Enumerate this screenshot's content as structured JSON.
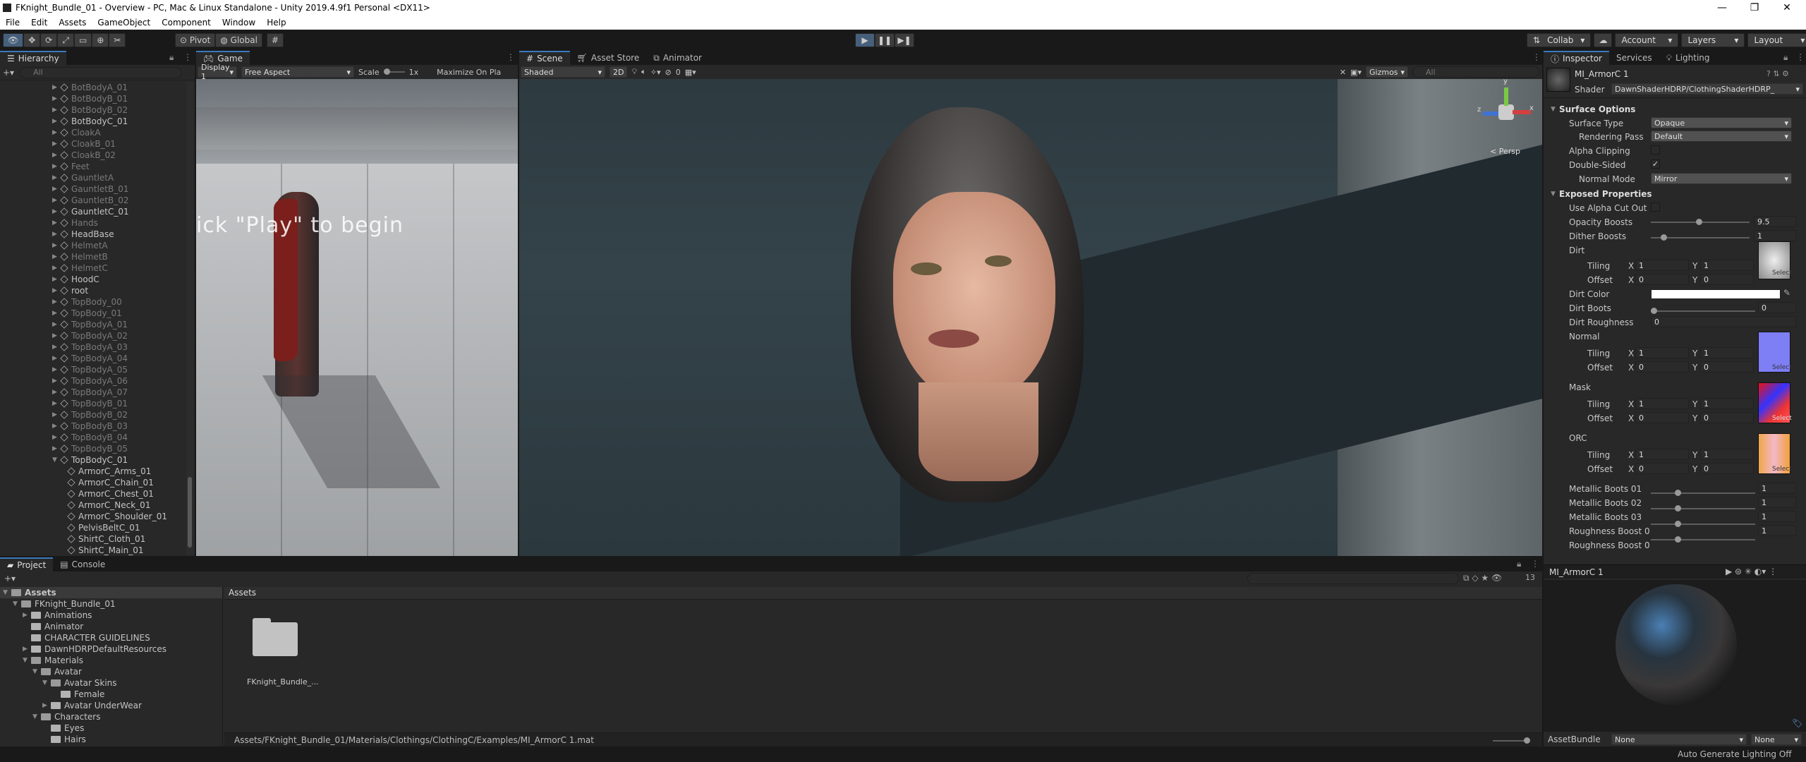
{
  "window": {
    "title": "FKnight_Bundle_01 - Overview - PC, Mac & Linux Standalone - Unity 2019.4.9f1 Personal <DX11>"
  },
  "menu": [
    "File",
    "Edit",
    "Assets",
    "GameObject",
    "Component",
    "Window",
    "Help"
  ],
  "toolbar": {
    "pivot": "Pivot",
    "global": "Global",
    "collab": "Collab",
    "account": "Account",
    "layers": "Layers",
    "layout": "Layout"
  },
  "hierarchy": {
    "tab": "Hierarchy",
    "search_placeholder": "All",
    "items": [
      {
        "label": "BotBodyA_01",
        "dim": true,
        "depth": 1
      },
      {
        "label": "BotBodyB_01",
        "dim": true,
        "depth": 1
      },
      {
        "label": "BotBodyB_02",
        "dim": true,
        "depth": 1
      },
      {
        "label": "BotBodyC_01",
        "dim": false,
        "depth": 1
      },
      {
        "label": "CloakA",
        "dim": true,
        "depth": 1
      },
      {
        "label": "CloakB_01",
        "dim": true,
        "depth": 1
      },
      {
        "label": "CloakB_02",
        "dim": true,
        "depth": 1
      },
      {
        "label": "Feet",
        "dim": true,
        "depth": 1
      },
      {
        "label": "GauntletA",
        "dim": true,
        "depth": 1
      },
      {
        "label": "GauntletB_01",
        "dim": true,
        "depth": 1
      },
      {
        "label": "GauntletB_02",
        "dim": true,
        "depth": 1
      },
      {
        "label": "GauntletC_01",
        "dim": false,
        "depth": 1
      },
      {
        "label": "Hands",
        "dim": true,
        "depth": 1
      },
      {
        "label": "HeadBase",
        "dim": false,
        "depth": 1
      },
      {
        "label": "HelmetA",
        "dim": true,
        "depth": 1
      },
      {
        "label": "HelmetB",
        "dim": true,
        "depth": 1
      },
      {
        "label": "HelmetC",
        "dim": true,
        "depth": 1
      },
      {
        "label": "HoodC",
        "dim": false,
        "depth": 1
      },
      {
        "label": "root",
        "dim": false,
        "depth": 1
      },
      {
        "label": "TopBody_00",
        "dim": true,
        "depth": 1
      },
      {
        "label": "TopBody_01",
        "dim": true,
        "depth": 1
      },
      {
        "label": "TopBodyA_01",
        "dim": true,
        "depth": 1
      },
      {
        "label": "TopBodyA_02",
        "dim": true,
        "depth": 1
      },
      {
        "label": "TopBodyA_03",
        "dim": true,
        "depth": 1
      },
      {
        "label": "TopBodyA_04",
        "dim": true,
        "depth": 1
      },
      {
        "label": "TopBodyA_05",
        "dim": true,
        "depth": 1
      },
      {
        "label": "TopBodyA_06",
        "dim": true,
        "depth": 1
      },
      {
        "label": "TopBodyA_07",
        "dim": true,
        "depth": 1
      },
      {
        "label": "TopBodyB_01",
        "dim": true,
        "depth": 1
      },
      {
        "label": "TopBodyB_02",
        "dim": true,
        "depth": 1
      },
      {
        "label": "TopBodyB_03",
        "dim": true,
        "depth": 1
      },
      {
        "label": "TopBodyB_04",
        "dim": true,
        "depth": 1
      },
      {
        "label": "TopBodyB_05",
        "dim": true,
        "depth": 1
      },
      {
        "label": "TopBodyC_01",
        "dim": false,
        "depth": 1,
        "open": true
      },
      {
        "label": "ArmorC_Arms_01",
        "dim": false,
        "depth": 2
      },
      {
        "label": "ArmorC_Chain_01",
        "dim": false,
        "depth": 2
      },
      {
        "label": "ArmorC_Chest_01",
        "dim": false,
        "depth": 2
      },
      {
        "label": "ArmorC_Neck_01",
        "dim": false,
        "depth": 2
      },
      {
        "label": "ArmorC_Shoulder_01",
        "dim": false,
        "depth": 2
      },
      {
        "label": "PelvisBeltC_01",
        "dim": false,
        "depth": 2
      },
      {
        "label": "ShirtC_Cloth_01",
        "dim": false,
        "depth": 2
      },
      {
        "label": "ShirtC_Main_01",
        "dim": false,
        "depth": 2
      }
    ]
  },
  "game": {
    "tab": "Game",
    "display": "Display 1",
    "aspect": "Free Aspect",
    "scale_label": "Scale",
    "scale_value": "1x",
    "maximize": "Maximize On Pla",
    "overlay_text": "ick \"Play\" to begin"
  },
  "scene": {
    "tab": "Scene",
    "asset_store": "Asset Store",
    "animator": "Animator",
    "shading": "Shaded",
    "mode2d": "2D",
    "gizmos": "Gizmos",
    "search_placeholder": "All",
    "persp": "< Persp",
    "fx_count": "0",
    "axis_x": "x",
    "axis_y": "y",
    "axis_z": "z"
  },
  "inspector": {
    "tabs": [
      "Inspector",
      "Services",
      "Lighting"
    ],
    "material_name": "MI_ArmorC 1",
    "shader_label": "Shader",
    "shader_value": "DawnShaderHDRP/ClothingShaderHDRP_",
    "surface_options": "Surface Options",
    "surface_type_label": "Surface Type",
    "surface_type": "Opaque",
    "rendering_pass_label": "Rendering Pass",
    "rendering_pass": "Default",
    "alpha_clipping": "Alpha Clipping",
    "double_sided": "Double-Sided",
    "double_sided_check": "✓",
    "normal_mode_label": "Normal Mode",
    "normal_mode": "Mirror",
    "exposed": "Exposed Properties",
    "use_alpha_cut": "Use Alpha Cut Out",
    "opacity_label": "Opacity Boosts",
    "opacity_value": "9.5",
    "dither_label": "Dither Boosts",
    "dither_value": "1",
    "dirt": "Dirt",
    "tiling": "Tiling",
    "offset": "Offset",
    "x": "X",
    "y": "Y",
    "one": "1",
    "zero": "0",
    "dirt_color": "Dirt Color",
    "dirt_boots_label": "Dirt Boots",
    "dirt_boots_value": "0",
    "dirt_roughness_label": "Dirt Roughness",
    "dirt_roughness_value": "0",
    "normal": "Normal",
    "mask": "Mask",
    "orc": "ORC",
    "select": "Select",
    "metallic1": "Metallic Boots 01",
    "metallic2": "Metallic Boots 02",
    "metallic3": "Metallic Boots 03",
    "roughness0": "Roughness Boost 0",
    "roughness1": "Roughness Boost 0",
    "preview_name": "MI_ArmorC 1",
    "assetbundle_label": "AssetBundle",
    "assetbundle_value": "None",
    "assetbundle_variant": "None"
  },
  "project": {
    "tabs": [
      "Project",
      "Console"
    ],
    "badge": "13",
    "tree": [
      {
        "label": "Assets",
        "depth": 0,
        "open": true,
        "bold": true
      },
      {
        "label": "FKnight_Bundle_01",
        "depth": 1,
        "open": true
      },
      {
        "label": "Animations",
        "depth": 2,
        "open": false
      },
      {
        "label": "Animator",
        "depth": 2,
        "open": null
      },
      {
        "label": "CHARACTER GUIDELINES",
        "depth": 2,
        "open": null
      },
      {
        "label": "DawnHDRPDefaultResources",
        "depth": 2,
        "open": false
      },
      {
        "label": "Materials",
        "depth": 2,
        "open": true
      },
      {
        "label": "Avatar",
        "depth": 3,
        "open": true
      },
      {
        "label": "Avatar Skins",
        "depth": 4,
        "open": true
      },
      {
        "label": "Female",
        "depth": 5,
        "open": null
      },
      {
        "label": "Avatar UnderWear",
        "depth": 4,
        "open": false
      },
      {
        "label": "Characters",
        "depth": 3,
        "open": true
      },
      {
        "label": "Eyes",
        "depth": 4,
        "open": null
      },
      {
        "label": "Hairs",
        "depth": 4,
        "open": null
      }
    ],
    "breadcrumb": "Assets",
    "folder_name": "FKnight_Bundle_...",
    "path": "Assets/FKnight_Bundle_01/Materials/Clothings/ClothingC/Examples/MI_ArmorC 1.mat"
  },
  "status": {
    "text": "Auto Generate Lighting Off"
  }
}
